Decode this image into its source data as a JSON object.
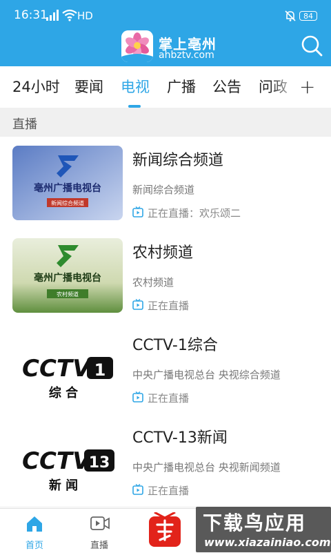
{
  "statusbar": {
    "time": "16:31",
    "network": "HD",
    "battery": "84"
  },
  "header": {
    "title": "掌上亳州",
    "subtitle": "ahbztv.com"
  },
  "tabs": [
    {
      "label": "24小时"
    },
    {
      "label": "要闻"
    },
    {
      "label": "电视",
      "active": true
    },
    {
      "label": "广播"
    },
    {
      "label": "公告"
    },
    {
      "label": "问政"
    }
  ],
  "add_tab": "+",
  "section_title": "直播",
  "channels": [
    {
      "title": "新闻综合频道",
      "desc": "新闻综合频道",
      "status": "正在直播：欢乐颂二",
      "thumb_caption": "亳州广播电视台",
      "thumb_band": "新闻综合频道"
    },
    {
      "title": "农村频道",
      "desc": "农村频道",
      "status": "正在直播",
      "thumb_caption": "亳州广播电视台",
      "thumb_band": "农村频道"
    },
    {
      "title": "CCTV-1综合",
      "desc": "中央广播电视总台 央视综合频道",
      "status": "正在直播",
      "thumb_caption": "综  合",
      "thumb_band": "1"
    },
    {
      "title": "CCTV-13新闻",
      "desc": "中央广播电视总台 央视新闻频道",
      "status": "正在直播",
      "thumb_caption": "新  闻",
      "thumb_band": "13"
    }
  ],
  "bottom_nav": [
    {
      "label": "首页",
      "icon": "home-icon",
      "active": true
    },
    {
      "label": "直播",
      "icon": "video-icon"
    }
  ],
  "watermark": {
    "title": "下载鸟应用",
    "sub": "www.xiazainiao.com"
  },
  "colors": {
    "accent": "#2ea6e6",
    "header_bg": "#2ea6e6"
  }
}
